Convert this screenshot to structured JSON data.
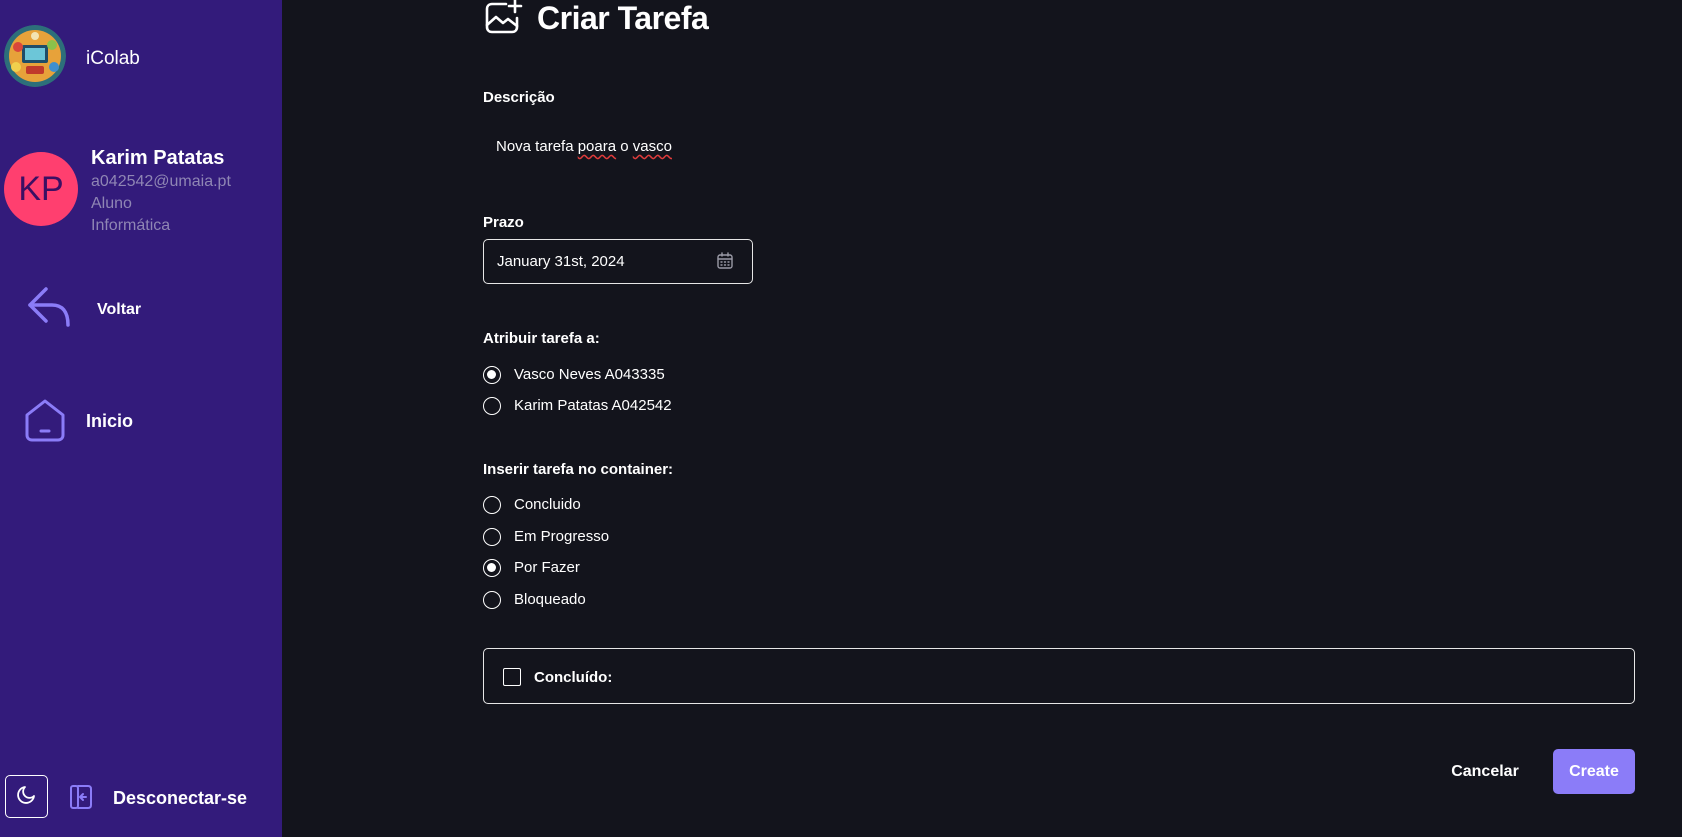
{
  "app": {
    "name": "iColab"
  },
  "user": {
    "initials": "KP",
    "name": "Karim Patatas",
    "email": "a042542@umaia.pt",
    "role": "Aluno",
    "department": "Informática"
  },
  "nav": {
    "back_label": "Voltar",
    "home_label": "Inicio",
    "logout_label": "Desconectar-se"
  },
  "page": {
    "title": "Criar Tarefa"
  },
  "form": {
    "description": {
      "label": "Descrição",
      "value_part1": "Nova tarefa ",
      "value_misspelled": "poara",
      "value_part2": " o ",
      "value_part3": "vasco"
    },
    "deadline": {
      "label": "Prazo",
      "value": "January 31st, 2024"
    },
    "assign": {
      "label": "Atribuir tarefa a:",
      "options": [
        {
          "label": "Vasco Neves A043335",
          "checked": true
        },
        {
          "label": "Karim Patatas A042542",
          "checked": false
        }
      ]
    },
    "container": {
      "label": "Inserir tarefa no container:",
      "options": [
        {
          "label": "Concluido",
          "checked": false
        },
        {
          "label": "Em Progresso",
          "checked": false
        },
        {
          "label": "Por Fazer",
          "checked": true
        },
        {
          "label": "Bloqueado",
          "checked": false
        }
      ]
    },
    "completed": {
      "label": "Concluído:",
      "checked": false
    }
  },
  "actions": {
    "cancel_label": "Cancelar",
    "create_label": "Create"
  },
  "colors": {
    "sidebar": "#331b7b",
    "background": "#13141c",
    "accent": "#8b7cf8",
    "avatar": "#ff3f6f"
  },
  "icons": {
    "logo": "colorful-illustration-logo",
    "back": "reply-arrow-icon",
    "home": "home-icon",
    "theme": "moon-icon",
    "logout": "logout-icon",
    "title": "add-image-icon",
    "calendar": "calendar-icon"
  }
}
